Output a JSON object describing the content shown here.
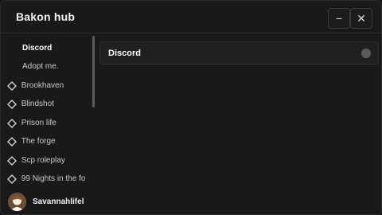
{
  "window": {
    "title": "Bakon hub"
  },
  "controls": {
    "minimize": "−",
    "close": "✕"
  },
  "sidebar": {
    "items": [
      {
        "label": "Discord",
        "icon": "none",
        "active": true
      },
      {
        "label": "Adopt me.",
        "icon": "none",
        "active": false
      },
      {
        "label": "Brookhaven",
        "icon": "diamond-icon",
        "active": false
      },
      {
        "label": "Blindshot",
        "icon": "diamond-icon",
        "active": false
      },
      {
        "label": "Prison life",
        "icon": "diamond-icon",
        "active": false
      },
      {
        "label": "The forge",
        "icon": "diamond-icon",
        "active": false
      },
      {
        "label": "Scp roleplay",
        "icon": "diamond-icon",
        "active": false
      },
      {
        "label": "99 Nights in the fo",
        "icon": "diamond-icon",
        "active": false
      }
    ]
  },
  "user": {
    "name": "Savannahlifel"
  },
  "main": {
    "section_title": "Discord"
  },
  "colors": {
    "background": "#191919",
    "accent": "#ffffff",
    "muted": "#c9c9c9"
  }
}
